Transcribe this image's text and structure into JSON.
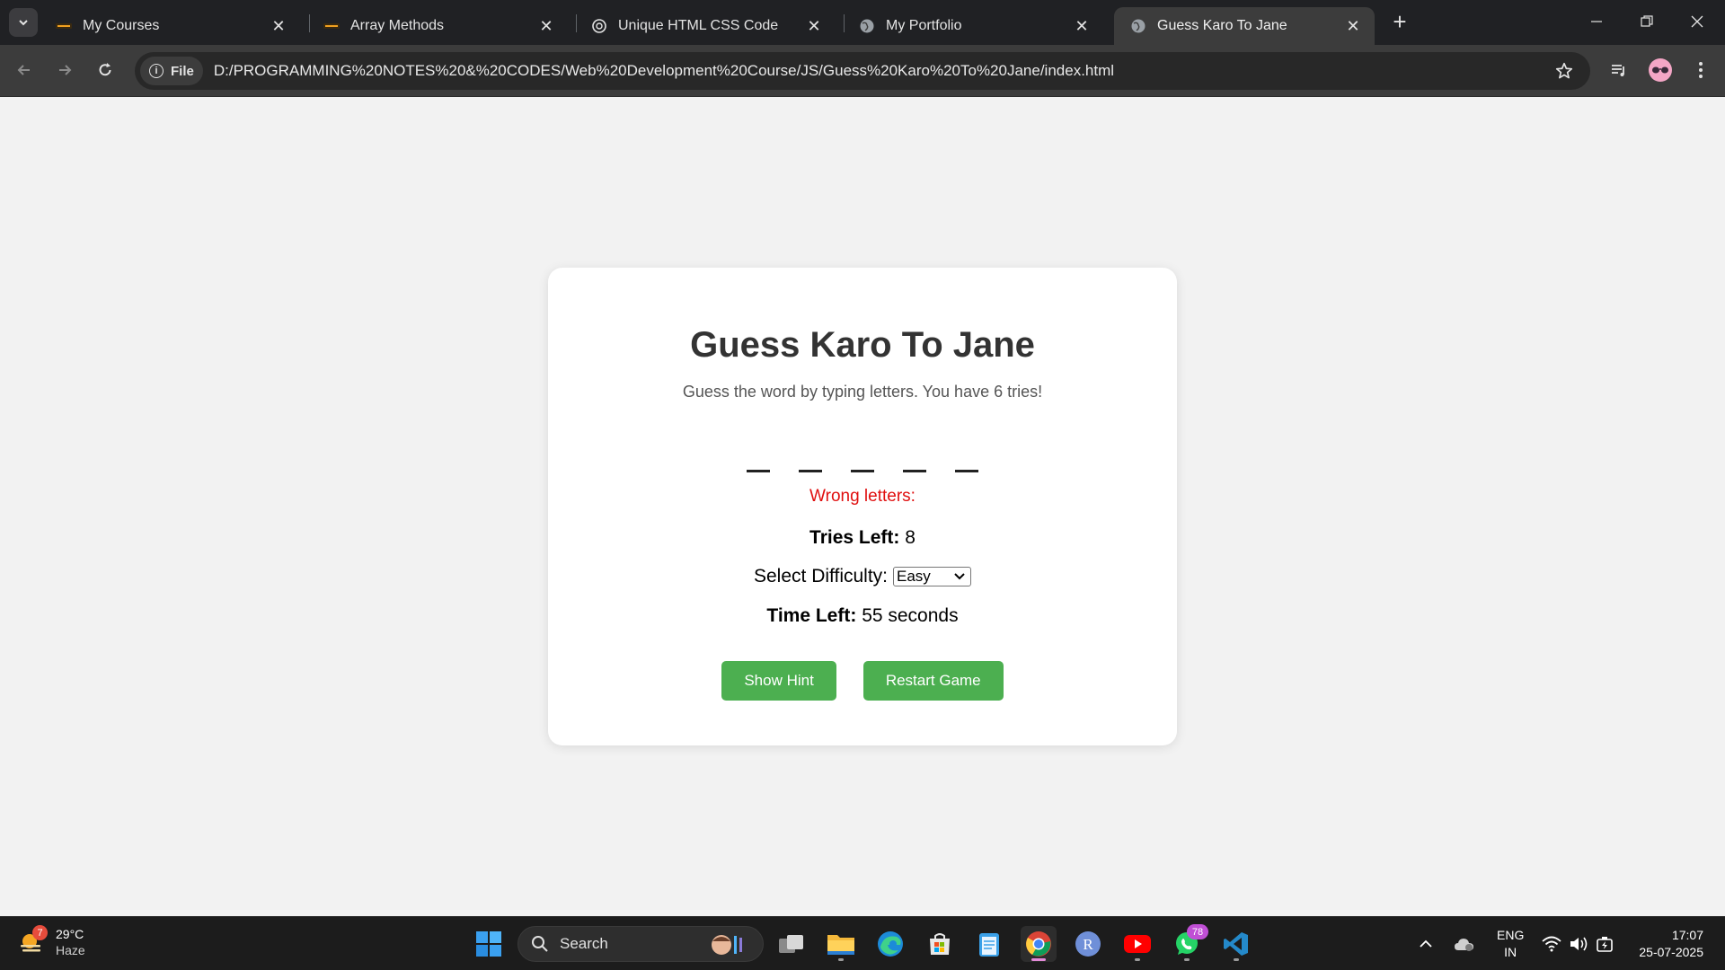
{
  "browser": {
    "tabs": [
      {
        "title": "My Courses"
      },
      {
        "title": "Array Methods"
      },
      {
        "title": "Unique HTML CSS Code"
      },
      {
        "title": "My Portfolio"
      },
      {
        "title": "Guess Karo To Jane"
      }
    ],
    "address": {
      "scheme_label": "File",
      "url": "D:/PROGRAMMING%20NOTES%20&%20CODES/Web%20Development%20Course/JS/Guess%20Karo%20To%20Jane/index.html"
    }
  },
  "game": {
    "title": "Guess Karo To Jane",
    "subtitle": "Guess the word by typing letters. You have 6 tries!",
    "word_slots": [
      "",
      "",
      "",
      "",
      ""
    ],
    "wrong_letters_label": "Wrong letters:",
    "tries_label": "Tries Left:",
    "tries_value": "8",
    "difficulty_label": "Select Difficulty:",
    "difficulty_value": "Easy",
    "time_label": "Time Left:",
    "time_value": "55 seconds",
    "hint_button": "Show Hint",
    "restart_button": "Restart Game",
    "colors": {
      "button": "#4caf50",
      "wrong": "#e01010"
    }
  },
  "taskbar": {
    "weather": {
      "temp": "29°C",
      "condition": "Haze",
      "badge": "7"
    },
    "search_placeholder": "Search",
    "whatsapp_badge": "78",
    "language": {
      "line1": "ENG",
      "line2": "IN"
    },
    "clock": {
      "time": "17:07",
      "date": "25-07-2025"
    }
  }
}
